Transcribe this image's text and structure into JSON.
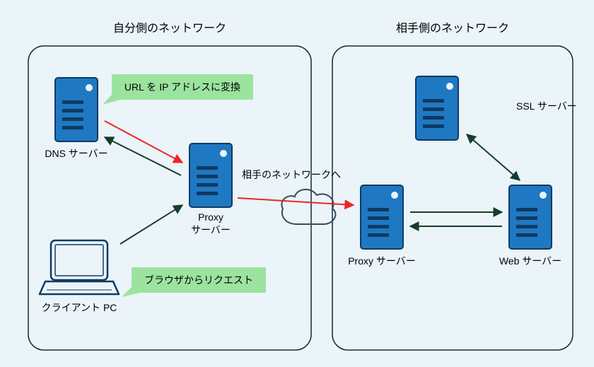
{
  "colors": {
    "bg": "#eaf4f9",
    "panel_stroke": "#0f2a3f",
    "node_fill": "#1f78c2",
    "node_stroke": "#0e3a63",
    "callout_fill": "#9be39f",
    "arrow_dark": "#173d2c",
    "arrow_red": "#f02424",
    "cloud_stroke": "#3a4a57"
  },
  "titles": {
    "left": "自分側のネットワーク",
    "right": "相手側のネットワーク"
  },
  "nodes": {
    "dns": {
      "label": "DNS サーバー"
    },
    "proxy_left": {
      "label_line1": "Proxy",
      "label_line2": "サーバー"
    },
    "client": {
      "label": "クライアント PC"
    },
    "proxy_right": {
      "label": "Proxy サーバー"
    },
    "ssl": {
      "label": "SSL サーバー"
    },
    "web": {
      "label": "Web サーバー"
    }
  },
  "callouts": {
    "dns": {
      "text": "URL を IP アドレスに変換"
    },
    "client": {
      "text": "ブラウザからリクエスト"
    }
  },
  "annotations": {
    "to_peer": "相手のネットワークへ"
  }
}
